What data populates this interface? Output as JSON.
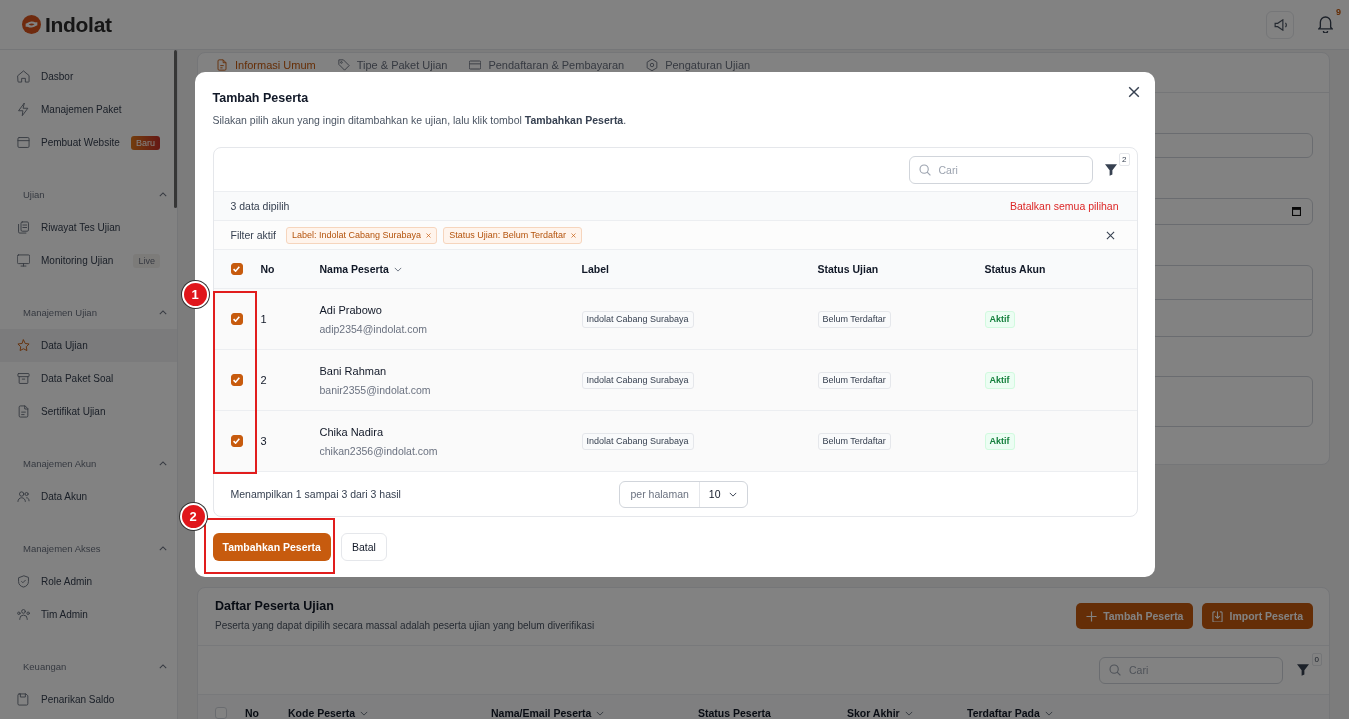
{
  "header": {
    "logo_text": "Indolat",
    "notification_count": "9"
  },
  "sidebar": {
    "sections": [
      {
        "items": [
          {
            "label": "Dasbor",
            "selected": false
          },
          {
            "label": "Manajemen Paket",
            "selected": false
          },
          {
            "label": "Pembuat Website",
            "selected": false,
            "badge": {
              "text": "Baru",
              "kind": "new"
            }
          }
        ]
      },
      {
        "title": "Ujian",
        "expanded": true,
        "items": [
          {
            "label": "Riwayat Tes Ujian",
            "selected": false
          },
          {
            "label": "Monitoring Ujian",
            "selected": false,
            "badge": {
              "text": "Live",
              "kind": "live"
            }
          }
        ]
      },
      {
        "title": "Manajemen Ujian",
        "expanded": true,
        "items": [
          {
            "label": "Data Ujian",
            "selected": true
          },
          {
            "label": "Data Paket Soal",
            "selected": false
          },
          {
            "label": "Sertifikat Ujian",
            "selected": false
          }
        ]
      },
      {
        "title": "Manajemen Akun",
        "expanded": true,
        "items": [
          {
            "label": "Data Akun",
            "selected": false
          }
        ]
      },
      {
        "title": "Manajemen Akses",
        "expanded": true,
        "items": [
          {
            "label": "Role Admin",
            "selected": false
          },
          {
            "label": "Tim Admin",
            "selected": false
          }
        ]
      },
      {
        "title": "Keuangan",
        "expanded": true,
        "items": [
          {
            "label": "Penarikan Saldo",
            "selected": false
          }
        ]
      }
    ]
  },
  "exam_form": {
    "tabs": [
      {
        "label": "Informasi Umum",
        "selected": true
      },
      {
        "label": "Tipe & Paket Ujian",
        "selected": false
      },
      {
        "label": "Pendaftaran & Pembayaran",
        "selected": false
      },
      {
        "label": "Pengaturan Ujian",
        "selected": false
      }
    ],
    "fields": [
      {
        "kind": "text"
      },
      {
        "kind": "date"
      },
      {
        "kind": "stacked"
      },
      {
        "kind": "area"
      }
    ]
  },
  "participants": {
    "title": "Daftar Peserta Ujian",
    "subtitle": "Peserta yang dapat dipilih secara massal adalah peserta ujian yang belum diverifikasi",
    "buttons": [
      {
        "label": "Tambah Peserta",
        "kind": "add"
      },
      {
        "label": "Import Peserta",
        "kind": "import"
      }
    ],
    "search": {
      "placeholder": "Cari"
    },
    "filter_count": "0",
    "table": {
      "select_all_checked": false,
      "columns": [
        {
          "label": "No",
          "sortable": false
        },
        {
          "label": "Kode Peserta",
          "sortable": true
        },
        {
          "label": "Nama/Email Peserta",
          "sortable": true
        },
        {
          "label": "Status Peserta",
          "sortable": false
        },
        {
          "label": "Skor Akhir",
          "sortable": true
        },
        {
          "label": "Terdaftar Pada",
          "sortable": true
        }
      ]
    }
  },
  "modal": {
    "title": "Tambah Peserta",
    "description": "Silakan pilih akun yang ingin ditambahkan ke ujian, lalu klik tombol **Tambahkan Peserta**.",
    "search": {
      "placeholder": "Cari"
    },
    "filter_count": "2",
    "selection": {
      "count_text": "3 data dipilih",
      "clear_link": "Batalkan semua pilihan"
    },
    "active_filters": {
      "label": "Filter aktif",
      "chips": [
        "Label: Indolat Cabang Surabaya",
        "Status Ujian: Belum Terdaftar"
      ]
    },
    "table": {
      "select_all_checked": true,
      "columns": [
        {
          "label": "No",
          "sortable": false
        },
        {
          "label": "Nama Peserta",
          "sortable": true
        },
        {
          "label": "Label",
          "sortable": false
        },
        {
          "label": "Status Ujian",
          "sortable": false
        },
        {
          "label": "Status Akun",
          "sortable": false
        }
      ],
      "rows": [
        {
          "checked": true,
          "no": "1",
          "name": "Adi Prabowo",
          "email": "adip2354@indolat.com",
          "label": "Indolat Cabang Surabaya",
          "exam_status": {
            "text": "Belum Terdaftar",
            "kind": "neutral"
          },
          "account_status": {
            "text": "Aktif",
            "kind": "active"
          }
        },
        {
          "checked": true,
          "no": "2",
          "name": "Bani Rahman",
          "email": "banir2355@indolat.com",
          "label": "Indolat Cabang Surabaya",
          "exam_status": {
            "text": "Belum Terdaftar",
            "kind": "neutral"
          },
          "account_status": {
            "text": "Aktif",
            "kind": "active"
          }
        },
        {
          "checked": true,
          "no": "3",
          "name": "Chika Nadira",
          "email": "chikan2356@indolat.com",
          "label": "Indolat Cabang Surabaya",
          "exam_status": {
            "text": "Belum Terdaftar",
            "kind": "neutral"
          },
          "account_status": {
            "text": "Aktif",
            "kind": "active"
          }
        }
      ]
    },
    "footer": {
      "summary": "Menampilkan 1 sampai 3 dari 3 hasil",
      "per_page_label": "per halaman",
      "per_page": "10"
    },
    "buttons": [
      {
        "label": "Tambahkan Peserta",
        "kind": "primary"
      },
      {
        "label": "Batal",
        "kind": "secondary"
      }
    ]
  },
  "annotations": [
    {
      "label": "1"
    },
    {
      "label": "2"
    }
  ]
}
